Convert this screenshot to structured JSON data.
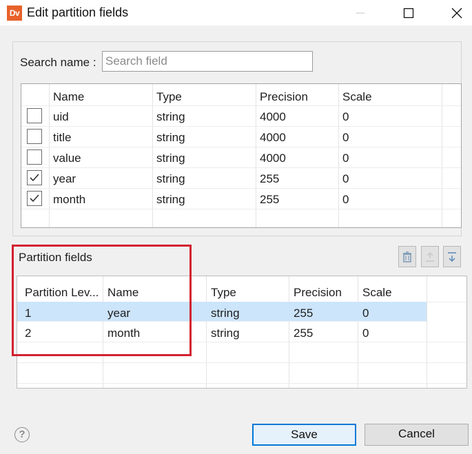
{
  "window": {
    "title": "Edit partition fields",
    "app_icon_text": "Dv"
  },
  "search": {
    "label": "Search name :",
    "placeholder": "Search field",
    "value": ""
  },
  "fields_table": {
    "headers": [
      "Name",
      "Type",
      "Precision",
      "Scale"
    ],
    "rows": [
      {
        "checked": false,
        "name": "uid",
        "type": "string",
        "precision": "4000",
        "scale": "0"
      },
      {
        "checked": false,
        "name": "title",
        "type": "string",
        "precision": "4000",
        "scale": "0"
      },
      {
        "checked": false,
        "name": "value",
        "type": "string",
        "precision": "4000",
        "scale": "0"
      },
      {
        "checked": true,
        "name": "year",
        "type": "string",
        "precision": "255",
        "scale": "0"
      },
      {
        "checked": true,
        "name": "month",
        "type": "string",
        "precision": "255",
        "scale": "0"
      }
    ]
  },
  "partition": {
    "section_label": "Partition fields",
    "headers": [
      "Partition Lev...",
      "Name",
      "Type",
      "Precision",
      "Scale"
    ],
    "rows": [
      {
        "level": "1",
        "name": "year",
        "type": "string",
        "precision": "255",
        "scale": "0",
        "selected": true
      },
      {
        "level": "2",
        "name": "month",
        "type": "string",
        "precision": "255",
        "scale": "0",
        "selected": false
      }
    ]
  },
  "toolbar": {
    "icons": [
      "trash-icon",
      "move-up-icon",
      "move-down-icon"
    ]
  },
  "buttons": {
    "save": "Save",
    "cancel": "Cancel",
    "help_glyph": "?"
  },
  "colors": {
    "highlight": "#d3202f",
    "selection": "#cce5fb",
    "accent": "#0078d7",
    "app_icon": "#e8622a"
  }
}
